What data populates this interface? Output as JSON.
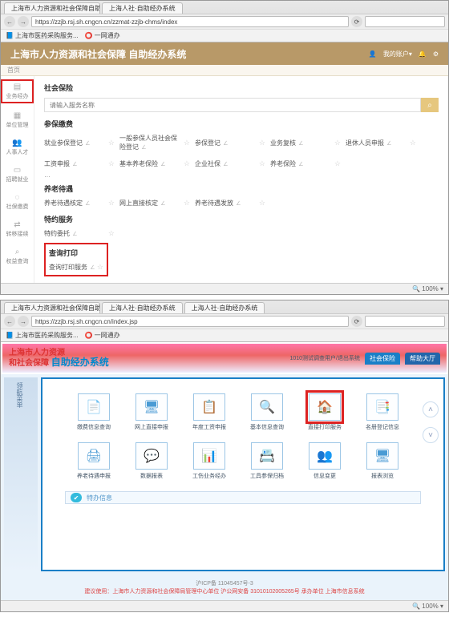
{
  "s1": {
    "tabs": [
      "上海市人力资源和社会保障自助...",
      "上海人社·自助经办系统"
    ],
    "url": "https://zzjb.rsj.sh.cngcn.cn/zzmat-zzjb-chms/index",
    "bookmarks": [
      "上海市医药采购服务...",
      "一网通办"
    ],
    "bannerTitle": "上海市人力资源和社会保障 自助经办系统",
    "userInfo": "我的账户▾",
    "tabInner": "首页",
    "sidebar": [
      "业务经办",
      "单位管理",
      "人事人才",
      "招聘就业",
      "社保缴费",
      "转移接续",
      "权益查询"
    ],
    "crumb": "社会保险",
    "searchPlaceholder": "请输入服务名称",
    "sec1": {
      "title": "参保缴费",
      "items": [
        "就业参保登记",
        "一般参保人员社会保险登记",
        "参保登记",
        "业务复核",
        "退休人员申报",
        "工资申报",
        "基本养老保险",
        "企业社保",
        "养老保险"
      ]
    },
    "extra": "…",
    "sec2": {
      "title": "养老待遇",
      "items": [
        "养老待遇核定",
        "网上直接核定",
        "养老待遇发放"
      ]
    },
    "sec3": {
      "title": "特约服务",
      "items": [
        "特约委托"
      ]
    },
    "sec4": {
      "title": "查询打印",
      "items": [
        "查询打印服务"
      ]
    },
    "zoom": "🔍 100% ▾"
  },
  "s2": {
    "tabs": [
      "上海市人力资源和社会保障自助...",
      "上海人社·自助经办系统",
      "上海人社·自助经办系统"
    ],
    "url": "https://zzjb.rsj.sh.cngcn.cn/index.jsp",
    "logo1": "上海市人力资源",
    "logo2": "和社会保障",
    "logo3": "自助经办系统",
    "right": "1010测试调查用户/退出系统",
    "tab1": "社会保险",
    "tab2": "帮助大厅",
    "sideTab": "领航菜单",
    "icons": [
      {
        "l": "缴费信息查询",
        "g": "📄"
      },
      {
        "l": "网上直接申报",
        "g": "🖥"
      },
      {
        "l": "年度工资申报",
        "g": "📋"
      },
      {
        "l": "基本信息查询",
        "g": "🔍"
      },
      {
        "l": "直接打印服务",
        "g": "🏠"
      },
      {
        "l": "名册登记信息",
        "g": "📑"
      },
      {
        "l": "养老待遇申报",
        "g": "🖨"
      },
      {
        "l": "数据报表",
        "g": "💬"
      },
      {
        "l": "工伤业务经办",
        "g": "📊"
      },
      {
        "l": "工具参保归档",
        "g": "📇"
      },
      {
        "l": "信息变更",
        "g": "👥"
      },
      {
        "l": "报表浏览",
        "g": "🖥"
      }
    ],
    "msg": "特办信息",
    "footer1": "沪ICP备 11045457号-3",
    "footer2": "建议使用：上海市人力资源和社会保障局管理中心单位  沪公网安备 31010102005265号  承办单位 上海市信息系统",
    "zoom": "🔍 100% ▾"
  }
}
